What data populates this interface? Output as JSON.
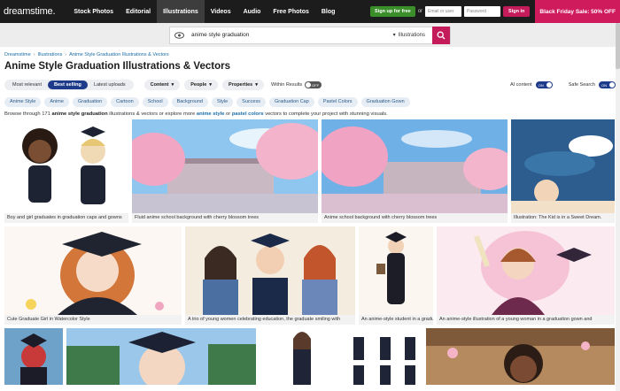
{
  "nav": {
    "logo_main": "dreams",
    "logo_rest": "time.",
    "links": [
      "Stock Photos",
      "Editorial",
      "Illustrations",
      "Videos",
      "Audio",
      "Free Photos",
      "Blog"
    ],
    "signup": "Sign up for free",
    "or": "or",
    "email_placeholder": "Email or user",
    "password_placeholder": "Password",
    "signin": "Sign in",
    "promo": "Black Friday Sale: 50% OFF"
  },
  "search": {
    "query": "anime style graduation",
    "filter": "Illustrations"
  },
  "breadcrumb": [
    "Dreamstime",
    "Illustrations",
    "Anime Style Graduation Illustrations & Vectors"
  ],
  "page_title": "Anime Style Graduation Illustrations & Vectors",
  "controls": {
    "sort": [
      "Most relevant",
      "Best selling",
      "Latest uploads"
    ],
    "dropdowns": [
      "Content",
      "People",
      "Properties"
    ],
    "within_results": "Within Results",
    "within_state": "OFF",
    "ai_content": "AI content",
    "ai_state": "ON",
    "safe_search": "Safe Search",
    "safe_state": "ON"
  },
  "tags": [
    "Anime Style",
    "Anime",
    "Graduation",
    "Cartoon",
    "School",
    "Background",
    "Style",
    "Success",
    "Graduation Cap",
    "Pastel Colors",
    "Graduation Gown"
  ],
  "description": {
    "p1": "Browse through 171 ",
    "b1": "anime style graduation",
    "p2": " illustrations & vectors or explore more ",
    "l1": "anime style",
    "p3": " or ",
    "l2": "pastel colors",
    "p4": " vectors to complete your project with stunning visuals."
  },
  "tiles": [
    "Boy and girl graduates in graduation caps and gowns",
    "Fluid anime school background with cherry blossom trees",
    "Anime school background with cherry blossom trees",
    "Illustration: The Kid is in a Sweet Dream.",
    "Cute Graduate Girl in Watercolor Style",
    "A trio of young women celebrating education, the graduate smiling with",
    "An anime-style student in a graduation",
    "An anime-style illustration of a young woman in a graduation gown and"
  ],
  "colors": {
    "brand": "#c41b5a",
    "nav_bg": "#1c1c1c",
    "active_seg": "#1e3a8a",
    "signup": "#3a8f2b"
  }
}
